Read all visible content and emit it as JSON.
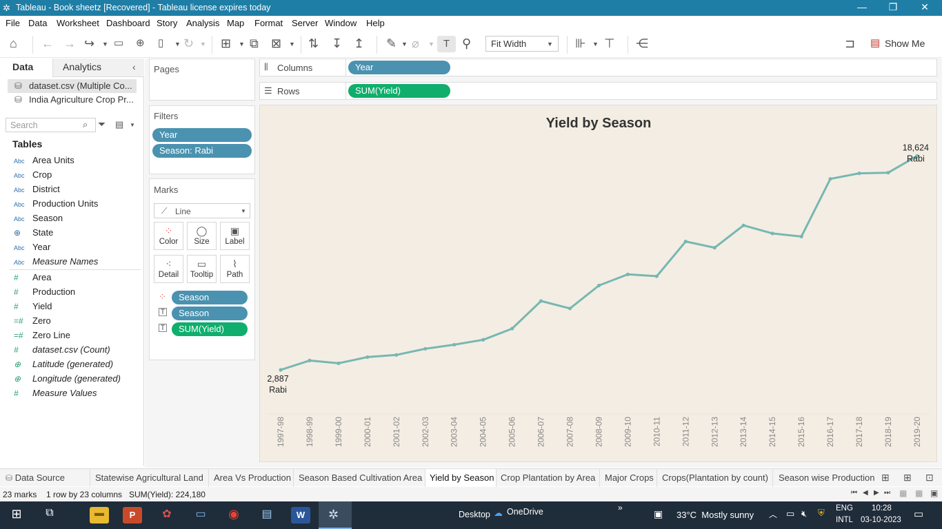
{
  "window": {
    "title": "Tableau - Book sheetz [Recovered] - Tableau license expires today"
  },
  "menu": [
    "File",
    "Data",
    "Worksheet",
    "Dashboard",
    "Story",
    "Analysis",
    "Map",
    "Format",
    "Server",
    "Window",
    "Help"
  ],
  "toolbar": {
    "fit_mode": "Fit Width",
    "show_me": "Show Me"
  },
  "left_pane": {
    "tabs": {
      "data": "Data",
      "analytics": "Analytics"
    },
    "datasources": [
      "dataset.csv (Multiple Co...",
      "India Agriculture Crop Pr..."
    ],
    "search_placeholder": "Search",
    "tables_heading": "Tables",
    "dimensions": [
      {
        "icon": "Abc",
        "name": "Area Units"
      },
      {
        "icon": "Abc",
        "name": "Crop"
      },
      {
        "icon": "Abc",
        "name": "District"
      },
      {
        "icon": "Abc",
        "name": "Production Units"
      },
      {
        "icon": "Abc",
        "name": "Season"
      },
      {
        "icon": "globe",
        "name": "State"
      },
      {
        "icon": "Abc",
        "name": "Year"
      },
      {
        "icon": "Abc",
        "name": "Measure Names"
      }
    ],
    "measures": [
      {
        "icon": "#",
        "name": "Area"
      },
      {
        "icon": "#",
        "name": "Production"
      },
      {
        "icon": "#",
        "name": "Yield"
      },
      {
        "icon": "#",
        "name": "Zero"
      },
      {
        "icon": "#",
        "name": "Zero Line"
      },
      {
        "icon": "#",
        "name": "dataset.csv (Count)"
      },
      {
        "icon": "globe",
        "name": "Latitude (generated)"
      },
      {
        "icon": "globe",
        "name": "Longitude (generated)"
      },
      {
        "icon": "#",
        "name": "Measure Values"
      }
    ]
  },
  "cards": {
    "pages": "Pages",
    "filters_title": "Filters",
    "filters": [
      "Year",
      "Season: Rabi"
    ],
    "marks_title": "Marks",
    "mark_type": "Line",
    "mark_buttons": [
      "Color",
      "Size",
      "Label",
      "Detail",
      "Tooltip",
      "Path"
    ],
    "mark_pills": [
      "Season",
      "Season",
      "SUM(Yield)"
    ]
  },
  "shelves": {
    "columns_label": "Columns",
    "columns_pill": "Year",
    "rows_label": "Rows",
    "rows_pill": "SUM(Yield)"
  },
  "chart_data": {
    "type": "line",
    "title": "Yield by Season",
    "categories": [
      "1997-98",
      "1998-99",
      "1999-00",
      "2000-01",
      "2001-02",
      "2002-03",
      "2003-04",
      "2004-05",
      "2005-06",
      "2006-07",
      "2007-08",
      "2008-09",
      "2009-10",
      "2010-11",
      "2011-12",
      "2012-13",
      "2013-14",
      "2014-15",
      "2015-16",
      "2016-17",
      "2017-18",
      "2018-19",
      "2019-20"
    ],
    "series": [
      {
        "name": "Rabi",
        "values": [
          2887,
          4400,
          3950,
          4950,
          5300,
          6300,
          6950,
          7750,
          9550,
          14000,
          12800,
          16500,
          18300,
          18000,
          23600,
          22600,
          26200,
          24900,
          24400,
          33700,
          34600,
          34700,
          37400
        ]
      }
    ],
    "start_label": {
      "value": "2,887",
      "series": "Rabi"
    },
    "end_label": {
      "value": "18,624",
      "series": "Rabi"
    },
    "ylim": [
      0,
      40000
    ],
    "line_color": "#76b7b2",
    "background": "#f4ede3",
    "grid": false
  },
  "sheet_tabs": [
    "Data Source",
    "Statewise Agricultural Land",
    "Area Vs Production",
    "Season Based Cultivation Area",
    "Yield by Season",
    "Crop Plantation by Area",
    "Major Crops",
    "Crops(Plantation by count)",
    "Season wise Production"
  ],
  "active_sheet": "Yield by Season",
  "status": {
    "marks": "23 marks",
    "dims": "1 row by 23 columns",
    "sum": "SUM(Yield): 224,180"
  },
  "taskbar": {
    "desktop": "Desktop",
    "onedrive": "OneDrive",
    "weather": "33°C  Mostly sunny",
    "lang1": "ENG",
    "lang2": "INTL",
    "time": "10:28",
    "date": "03-10-2023"
  }
}
